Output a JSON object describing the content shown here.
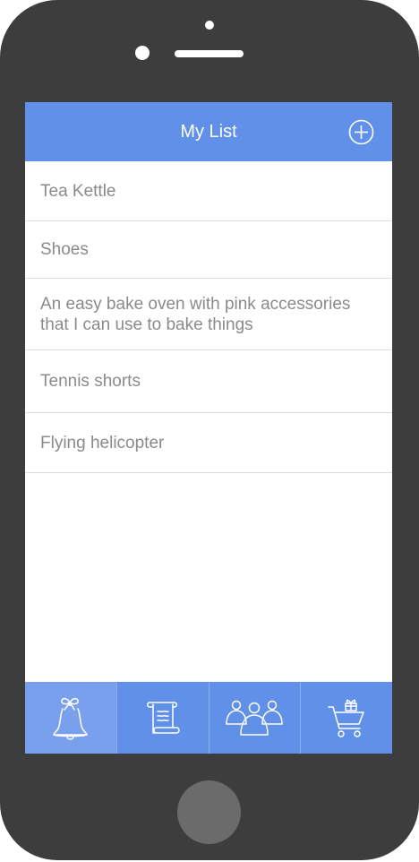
{
  "header": {
    "title": "My List",
    "add_icon": "plus-circle-icon"
  },
  "list": {
    "items": [
      {
        "label": "Tea Kettle"
      },
      {
        "label": "Shoes"
      },
      {
        "label": "An easy bake oven with pink accessories that I can use to bake things"
      },
      {
        "label": "Tennis shorts"
      },
      {
        "label": "Flying helicopter"
      }
    ]
  },
  "tabs": [
    {
      "icon": "bell-with-bow-icon",
      "active": true
    },
    {
      "icon": "scroll-list-icon",
      "active": false
    },
    {
      "icon": "people-group-icon",
      "active": false
    },
    {
      "icon": "shopping-cart-gift-icon",
      "active": false
    }
  ],
  "colors": {
    "accent": "#6190e8",
    "accent_active_tab": "#79a0ec",
    "device_body": "#3d3d3d",
    "item_text": "#8a8a8a",
    "divider": "#dcdcdc"
  }
}
